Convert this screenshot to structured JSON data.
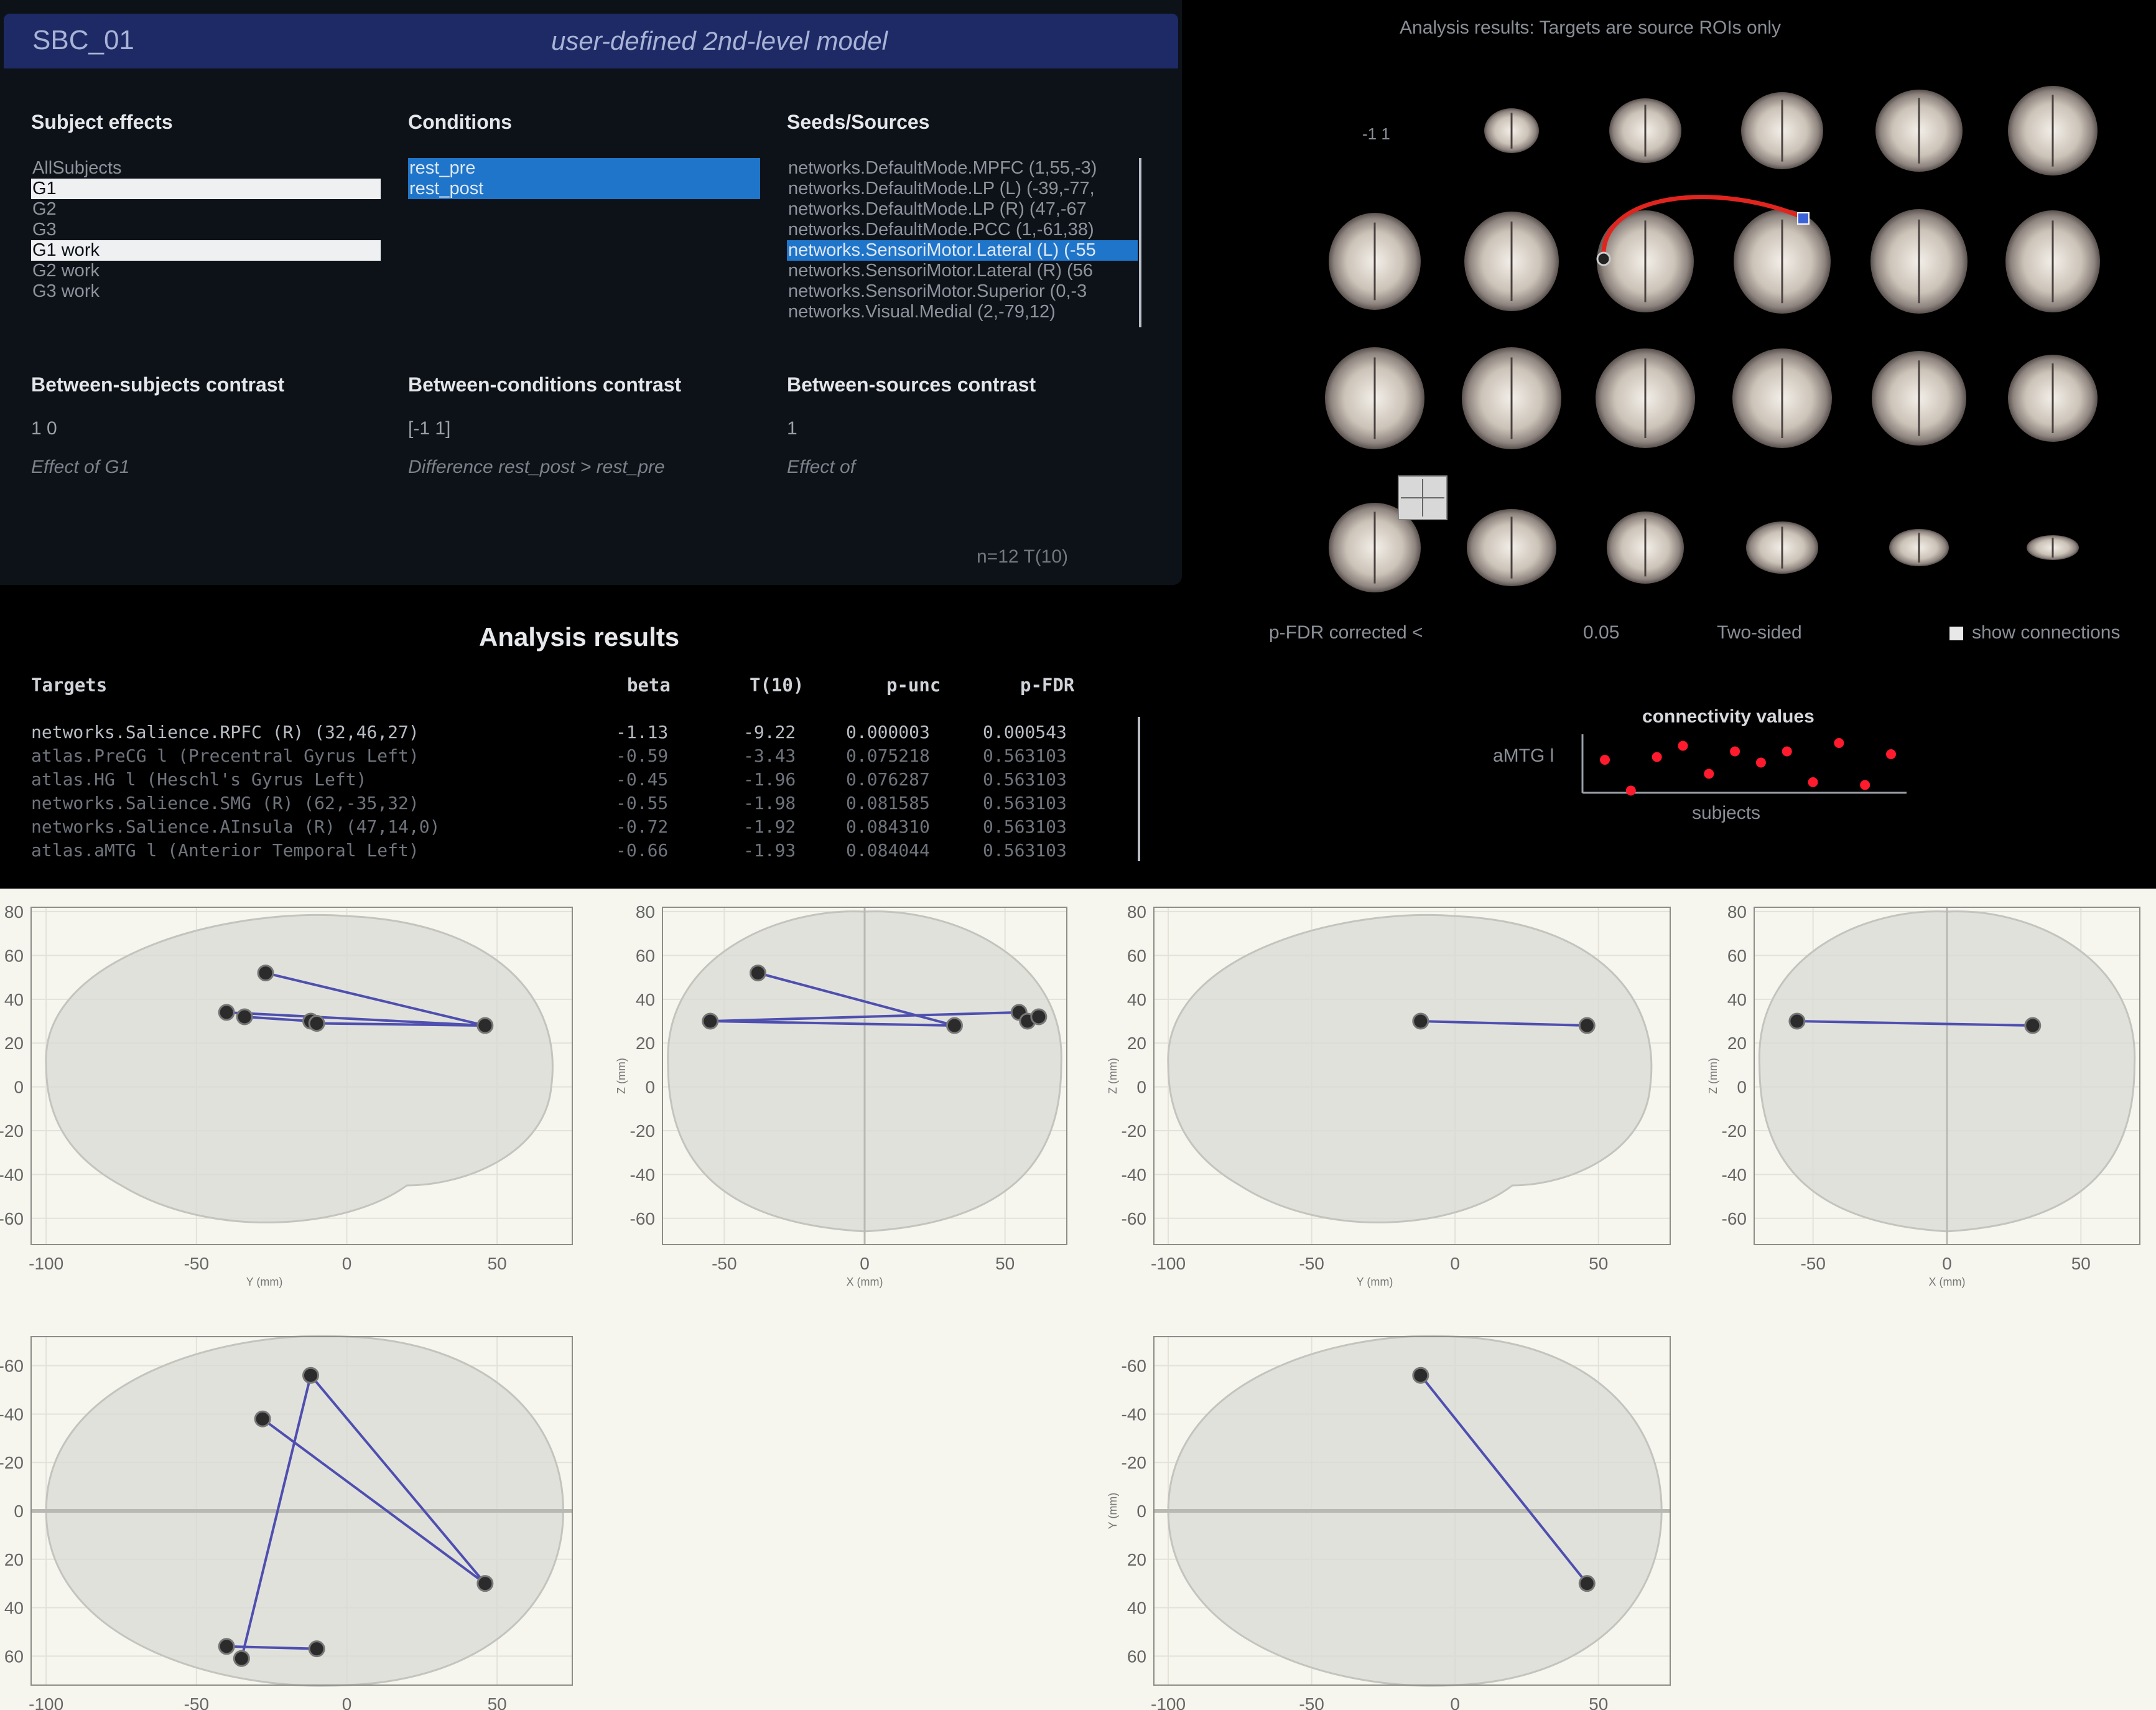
{
  "setup": {
    "analysis_name": "SBC_01",
    "model_label": "user-defined 2nd-level model",
    "subject_effects": {
      "heading": "Subject effects",
      "items": [
        {
          "label": "AllSubjects",
          "state": "normal"
        },
        {
          "label": "G1",
          "state": "selected"
        },
        {
          "label": "G2",
          "state": "normal"
        },
        {
          "label": "G3",
          "state": "normal"
        },
        {
          "label": "G1 work",
          "state": "selected"
        },
        {
          "label": "G2 work",
          "state": "normal"
        },
        {
          "label": "G3 work",
          "state": "normal"
        }
      ]
    },
    "conditions": {
      "heading": "Conditions",
      "items": [
        {
          "label": "rest_pre",
          "state": "active"
        },
        {
          "label": "rest_post",
          "state": "active"
        }
      ]
    },
    "seeds": {
      "heading": "Seeds/Sources",
      "items": [
        {
          "label": "networks.DefaultMode.MPFC (1,55,-3)",
          "state": "normal"
        },
        {
          "label": "networks.DefaultMode.LP (L) (-39,-77,",
          "state": "normal"
        },
        {
          "label": "networks.DefaultMode.LP (R) (47,-67",
          "state": "normal"
        },
        {
          "label": "networks.DefaultMode.PCC (1,-61,38)",
          "state": "normal"
        },
        {
          "label": "networks.SensoriMotor.Lateral (L) (-55",
          "state": "active"
        },
        {
          "label": "networks.SensoriMotor.Lateral (R) (56",
          "state": "normal"
        },
        {
          "label": "networks.SensoriMotor.Superior (0,-3",
          "state": "normal"
        },
        {
          "label": "networks.Visual.Medial (2,-79,12)",
          "state": "normal"
        }
      ]
    },
    "between_subjects": {
      "heading": "Between-subjects contrast",
      "value": "1 0",
      "description": "Effect of G1"
    },
    "between_conditions": {
      "heading": "Between-conditions contrast",
      "value": "[-1 1]",
      "description": "Difference rest_post > rest_pre"
    },
    "between_sources": {
      "heading": "Between-sources contrast",
      "value": "1",
      "description": "Effect of"
    },
    "stats_label": "n=12 T(10)"
  },
  "results": {
    "title": "Analysis results",
    "columns": [
      "Targets",
      "beta",
      "T(10)",
      "p-unc",
      "p-FDR"
    ],
    "rows": [
      {
        "target": "networks.Salience.RPFC (R) (32,46,27)",
        "beta": "-1.13",
        "t": "-9.22",
        "p_unc": "0.000003",
        "p_fdr": "0.000543"
      },
      {
        "target": "atlas.PreCG l (Precentral Gyrus Left)",
        "beta": "-0.59",
        "t": "-3.43",
        "p_unc": "0.075218",
        "p_fdr": "0.563103"
      },
      {
        "target": "atlas.HG l (Heschl's Gyrus Left)",
        "beta": "-0.45",
        "t": "-1.96",
        "p_unc": "0.076287",
        "p_fdr": "0.563103"
      },
      {
        "target": "networks.Salience.SMG (R) (62,-35,32)",
        "beta": "-0.55",
        "t": "-1.98",
        "p_unc": "0.081585",
        "p_fdr": "0.563103"
      },
      {
        "target": "networks.Salience.AInsula (R) (47,14,0)",
        "beta": "-0.72",
        "t": "-1.92",
        "p_unc": "0.084310",
        "p_fdr": "0.563103"
      },
      {
        "target": "atlas.aMTG l (Anterior Temporal Left)",
        "beta": "-0.66",
        "t": "-1.93",
        "p_unc": "0.084044",
        "p_fdr": "0.563103"
      }
    ]
  },
  "brain_view": {
    "header": "Analysis results: Targets are source ROIs only",
    "slice_label": "-1 1",
    "threshold_label": "p-FDR corrected <",
    "threshold_value": "0.05",
    "sidedness": "Two-sided",
    "show_connections_label": "show connections",
    "connection_color": "#e0251e",
    "seed_color": "#3a63d8"
  },
  "connectivity_values": {
    "title": "connectivity values",
    "ylabel": "aMTG l",
    "xlabel": "subjects",
    "point_color": "#ff1a2e",
    "values": [
      0.2,
      -0.9,
      0.3,
      0.7,
      -0.3,
      0.5,
      0.1,
      0.5,
      -0.6,
      0.8,
      -0.7,
      0.4
    ]
  },
  "glass_brains": {
    "line_color": "#4e4fb0",
    "node_color": "#2b2b2b",
    "x_ticks": [
      -100,
      -50,
      0,
      50
    ],
    "x_ticks_coronal": [
      -50,
      0,
      50
    ],
    "z_ticks": [
      80,
      60,
      40,
      20,
      0,
      -20,
      -40,
      -60
    ],
    "y_ticks_axial": [
      -60,
      -40,
      -20,
      0,
      20,
      40,
      60
    ],
    "axis_label_y": "Y (mm)",
    "axis_label_x": "X (mm)",
    "axis_label_z": "Z (mm)"
  }
}
